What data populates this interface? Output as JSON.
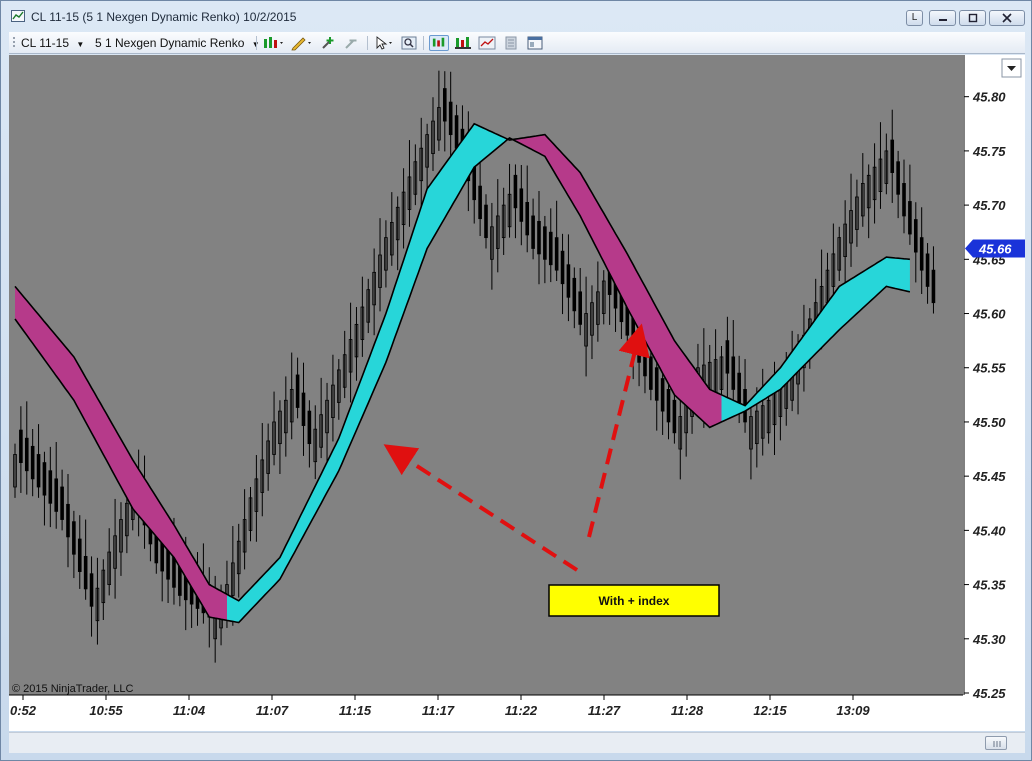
{
  "window": {
    "title": "CL 11-15 (5 1 Nexgen Dynamic Renko)  10/2/2015",
    "buttons": {
      "link": "L"
    }
  },
  "toolbar": {
    "instrument": "CL 11-15",
    "bar_type": "5 1 Nexgen Dynamic Renko",
    "icons": [
      "bar-style-icon",
      "drawing-pencil-icon",
      "zoom-in-icon",
      "zoom-out-icon",
      "cursor-icon",
      "search-icon",
      "indicators-icon",
      "strategies-icon",
      "chart-trader-icon",
      "data-box-icon",
      "properties-icon"
    ]
  },
  "chart": {
    "copyright": "© 2015 NinjaTrader, LLC",
    "annotation": "With + index",
    "price_label": "45.66",
    "colors": {
      "background": "#828282",
      "bar": "#000000",
      "ribbon_up": "#27d6d9",
      "ribbon_down": "#b63a8a",
      "annotation_bg": "#ffff00",
      "arrow": "#e01010",
      "price_tag": "#1a33d9"
    }
  },
  "chart_data": {
    "type": "ohlc",
    "x_ticks": [
      "0:52",
      "10:55",
      "11:04",
      "11:07",
      "11:15",
      "11:17",
      "11:22",
      "11:27",
      "11:28",
      "12:15",
      "13:09"
    ],
    "ylim": [
      45.25,
      45.82
    ],
    "y_ticks": [
      45.25,
      45.3,
      45.35,
      45.4,
      45.45,
      45.5,
      45.55,
      45.6,
      45.65,
      45.7,
      45.75,
      45.8
    ],
    "last_price": 45.66,
    "close_path": [
      [
        0,
        45.47
      ],
      [
        8,
        45.41
      ],
      [
        13,
        45.33
      ],
      [
        16,
        45.38
      ],
      [
        20,
        45.44
      ],
      [
        24,
        45.37
      ],
      [
        28,
        45.34
      ],
      [
        33,
        45.32
      ],
      [
        36,
        45.35
      ],
      [
        40,
        45.43
      ],
      [
        44,
        45.5
      ],
      [
        47,
        45.53
      ],
      [
        50,
        45.48
      ],
      [
        53,
        45.52
      ],
      [
        58,
        45.59
      ],
      [
        63,
        45.67
      ],
      [
        68,
        45.74
      ],
      [
        72,
        45.79
      ],
      [
        76,
        45.74
      ],
      [
        80,
        45.67
      ],
      [
        84,
        45.71
      ],
      [
        88,
        45.66
      ],
      [
        92,
        45.64
      ],
      [
        96,
        45.59
      ],
      [
        100,
        45.63
      ],
      [
        104,
        45.58
      ],
      [
        108,
        45.53
      ],
      [
        112,
        45.49
      ],
      [
        116,
        45.55
      ],
      [
        120,
        45.56
      ],
      [
        124,
        45.5
      ],
      [
        128,
        45.52
      ],
      [
        132,
        45.55
      ],
      [
        136,
        45.61
      ],
      [
        140,
        45.67
      ],
      [
        144,
        45.72
      ],
      [
        148,
        45.75
      ],
      [
        151,
        45.69
      ],
      [
        154,
        45.64
      ],
      [
        156,
        45.61
      ]
    ],
    "ribbon_upper": [
      [
        0,
        45.625
      ],
      [
        10,
        45.56
      ],
      [
        20,
        45.465
      ],
      [
        27,
        45.405
      ],
      [
        33,
        45.35
      ],
      [
        38,
        45.335
      ],
      [
        45,
        45.375
      ],
      [
        55,
        45.485
      ],
      [
        63,
        45.6
      ],
      [
        70,
        45.715
      ],
      [
        78,
        45.775
      ],
      [
        84,
        45.76
      ],
      [
        90,
        45.765
      ],
      [
        96,
        45.73
      ],
      [
        104,
        45.655
      ],
      [
        112,
        45.575
      ],
      [
        118,
        45.53
      ],
      [
        124,
        45.515
      ],
      [
        130,
        45.55
      ],
      [
        140,
        45.625
      ],
      [
        148,
        45.652
      ],
      [
        152,
        45.65
      ]
    ],
    "ribbon_lower": [
      [
        0,
        45.595
      ],
      [
        10,
        45.52
      ],
      [
        20,
        45.42
      ],
      [
        27,
        45.375
      ],
      [
        33,
        45.32
      ],
      [
        38,
        45.315
      ],
      [
        45,
        45.355
      ],
      [
        55,
        45.455
      ],
      [
        63,
        45.555
      ],
      [
        70,
        45.66
      ],
      [
        78,
        45.735
      ],
      [
        84,
        45.762
      ],
      [
        90,
        45.745
      ],
      [
        96,
        45.69
      ],
      [
        104,
        45.605
      ],
      [
        112,
        45.525
      ],
      [
        118,
        45.495
      ],
      [
        124,
        45.51
      ],
      [
        130,
        45.53
      ],
      [
        140,
        45.585
      ],
      [
        148,
        45.625
      ],
      [
        152,
        45.62
      ]
    ],
    "ribbon_flips": [
      [
        0,
        36,
        "down"
      ],
      [
        36,
        84,
        "up"
      ],
      [
        84,
        120,
        "down"
      ],
      [
        120,
        152,
        "up"
      ]
    ]
  }
}
